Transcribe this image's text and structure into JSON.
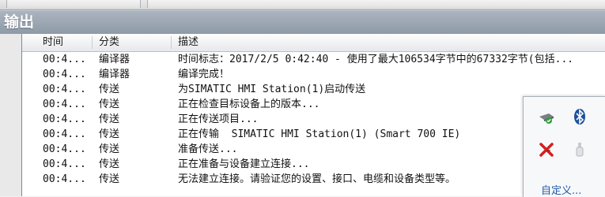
{
  "window": {
    "title": "输出"
  },
  "table": {
    "columns": [
      "时间",
      "分类",
      "描述"
    ],
    "rows": [
      {
        "time": "00:4...",
        "category": "编译器",
        "desc": "时间标志：2017/2/5 0:42:40 - 使用了最大106534字节中的67332字节(包括..."
      },
      {
        "time": "00:4...",
        "category": "编译器",
        "desc": "编译完成！"
      },
      {
        "time": "00:4...",
        "category": "传送",
        "desc": "为SIMATIC HMI Station(1)启动传送"
      },
      {
        "time": "00:4...",
        "category": "传送",
        "desc": "正在检查目标设备上的版本..."
      },
      {
        "time": "00:4...",
        "category": "传送",
        "desc": "正在传送项目..."
      },
      {
        "time": "00:4...",
        "category": "传送",
        "desc": "正在传输  SIMATIC HMI Station(1) (Smart 700 IE)"
      },
      {
        "time": "00:4...",
        "category": "传送",
        "desc": "准备传送..."
      },
      {
        "time": "00:4...",
        "category": "传送",
        "desc": "正在准备与设备建立连接..."
      },
      {
        "time": "00:4...",
        "category": "传送",
        "desc": "无法建立连接。请验证您的设置、接口、电缆和设备类型等。"
      }
    ]
  },
  "tray": {
    "customize_label": "自定义...",
    "icons": [
      "network-icon",
      "bluetooth-icon",
      "error-x-icon",
      "usb-icon"
    ],
    "colors": {
      "link": "#1e5aa8",
      "error": "#d42020",
      "bluetooth": "#1f4f9c"
    }
  }
}
